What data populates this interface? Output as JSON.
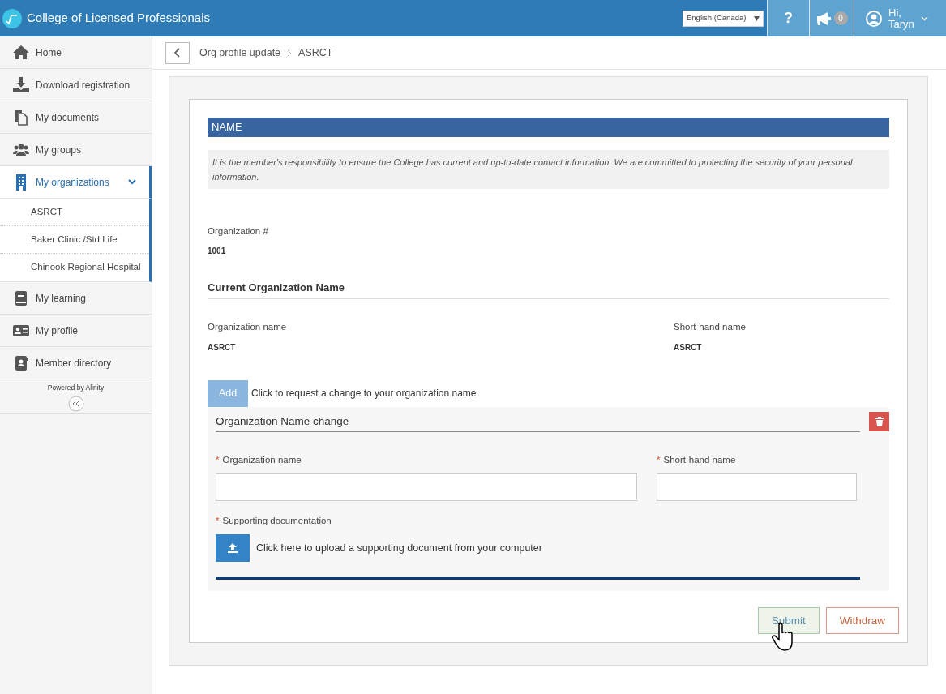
{
  "header": {
    "title": "College of Licensed Professionals",
    "language": "English (Canada)",
    "help": "?",
    "notifications": "0",
    "greeting": "Hi,",
    "user": "Taryn"
  },
  "sidebar": {
    "items": [
      {
        "label": "Home",
        "selected": false
      },
      {
        "label": "Download registration",
        "selected": false
      },
      {
        "label": "My documents",
        "selected": false
      },
      {
        "label": "My groups",
        "selected": false
      },
      {
        "label": "My organizations",
        "selected": true,
        "expanded": true,
        "children": [
          {
            "label": "ASRCT",
            "selected": false
          },
          {
            "label": "Baker Clinic /Std Life",
            "selected": false
          },
          {
            "label": "Chinook Regional Hospital",
            "selected": false
          }
        ]
      },
      {
        "label": "My learning",
        "selected": false
      },
      {
        "label": "My profile",
        "selected": false
      },
      {
        "label": "Member directory",
        "selected": false
      }
    ],
    "footer": "Powered by Alinity"
  },
  "breadcrumb": [
    "Org profile update",
    "ASRCT"
  ],
  "form": {
    "section_title": "NAME",
    "notice": "It is the member's responsibility to ensure the College has current and up-to-date contact information. We are committed to protecting the security of your personal information.",
    "org_number": {
      "label": "Organization #",
      "value": "1001"
    },
    "subheading": "Current Organization Name",
    "current": [
      {
        "label": "Organization name",
        "value": "ASRCT"
      },
      {
        "label": "Short-hand name",
        "value": "ASRCT"
      }
    ],
    "add_button": "Add",
    "add_hint": "Click to request a change to your organization name",
    "change": {
      "title": "Organization Name change",
      "fields": [
        {
          "marker": "*",
          "label": "Organization name"
        },
        {
          "marker": "*",
          "label": "Short-hand name"
        }
      ],
      "upload": {
        "marker": "*",
        "label": "Supporting documentation",
        "text": "Click here to upload a supporting document from your computer"
      }
    },
    "buttons": [
      {
        "kind": "submit",
        "label": "Submit",
        "hovered": true
      },
      {
        "kind": "withdraw",
        "label": "Withdraw",
        "hovered": false
      }
    ]
  }
}
